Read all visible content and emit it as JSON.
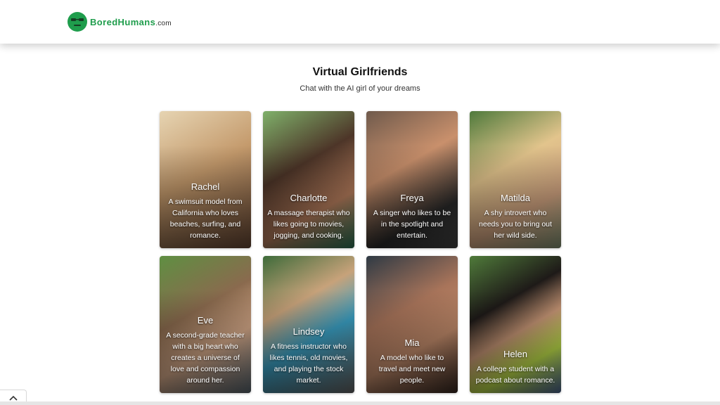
{
  "brand": {
    "name": "BoredHumans",
    "domain": ".com",
    "color": "#1f9d4c"
  },
  "page": {
    "title": "Virtual Girlfriends",
    "subtitle": "Chat with the AI girl of your dreams"
  },
  "cards": [
    {
      "name": "Rachel",
      "description": "A swimsuit model from California who loves beaches, surfing, and romance."
    },
    {
      "name": "Charlotte",
      "description": "A massage therapist who likes going to movies, jogging, and cooking."
    },
    {
      "name": "Freya",
      "description": "A singer who likes to be in the spotlight and entertain."
    },
    {
      "name": "Matilda",
      "description": "A shy introvert who needs you to bring out her wild side."
    },
    {
      "name": "Eve",
      "description": "A second-grade teacher with a big heart who creates a universe of love and compassion around her."
    },
    {
      "name": "Lindsey",
      "description": "A fitness instructor who likes tennis, old movies, and playing the stock market."
    },
    {
      "name": "Mia",
      "description": "A model who like to travel and meet new people."
    },
    {
      "name": "Helen",
      "description": "A college student with a podcast about romance."
    }
  ],
  "icons": {
    "logo": "smiley-face-icon",
    "scroll_top": "chevron-up-icon"
  }
}
